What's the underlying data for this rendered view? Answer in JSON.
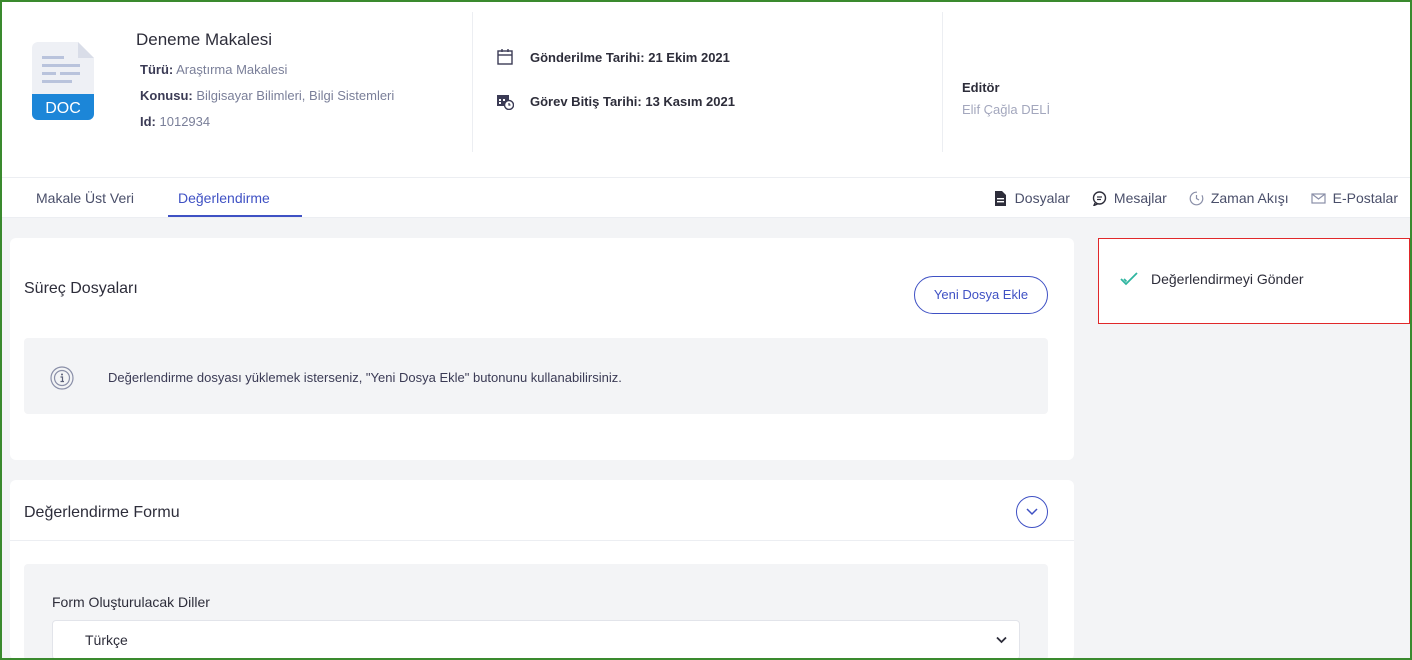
{
  "article": {
    "title": "Deneme Makalesi",
    "type_label": "Türü:",
    "type_value": "Araştırma Makalesi",
    "subject_label": "Konusu:",
    "subject_value": "Bilgisayar Bilimleri, Bilgi Sistemleri",
    "id_label": "Id:",
    "id_value": "1012934",
    "icon_text": "DOC"
  },
  "dates": {
    "sent": "Gönderilme Tarihi: 21 Ekim 2021",
    "due": "Görev Bitiş Tarihi: 13 Kasım 2021"
  },
  "editor": {
    "label": "Editör",
    "name": "Elif Çağla DELİ"
  },
  "tabs": {
    "left": [
      "Makale Üst Veri",
      "Değerlendirme"
    ],
    "active": "Değerlendirme",
    "right": [
      {
        "label": "Dosyalar",
        "icon": "file-icon"
      },
      {
        "label": "Mesajlar",
        "icon": "chat-icon"
      },
      {
        "label": "Zaman Akışı",
        "icon": "clock-icon"
      },
      {
        "label": "E-Postalar",
        "icon": "mail-icon"
      }
    ]
  },
  "process_files": {
    "title": "Süreç Dosyaları",
    "add_button": "Yeni Dosya Ekle",
    "info": "Değerlendirme dosyası yüklemek isterseniz, \"Yeni Dosya Ekle\" butonunu kullanabilirsiniz."
  },
  "evaluation_form": {
    "title": "Değerlendirme Formu",
    "languages_label": "Form Oluşturulacak Diller",
    "selected_language": "Türkçe"
  },
  "side_panel": {
    "send_label": "Değerlendirmeyi Gönder"
  },
  "colors": {
    "accent": "#3f51c4",
    "success": "#2fb5a0",
    "highlight_border": "#e0282a",
    "frame_border": "#3a8a2e"
  }
}
